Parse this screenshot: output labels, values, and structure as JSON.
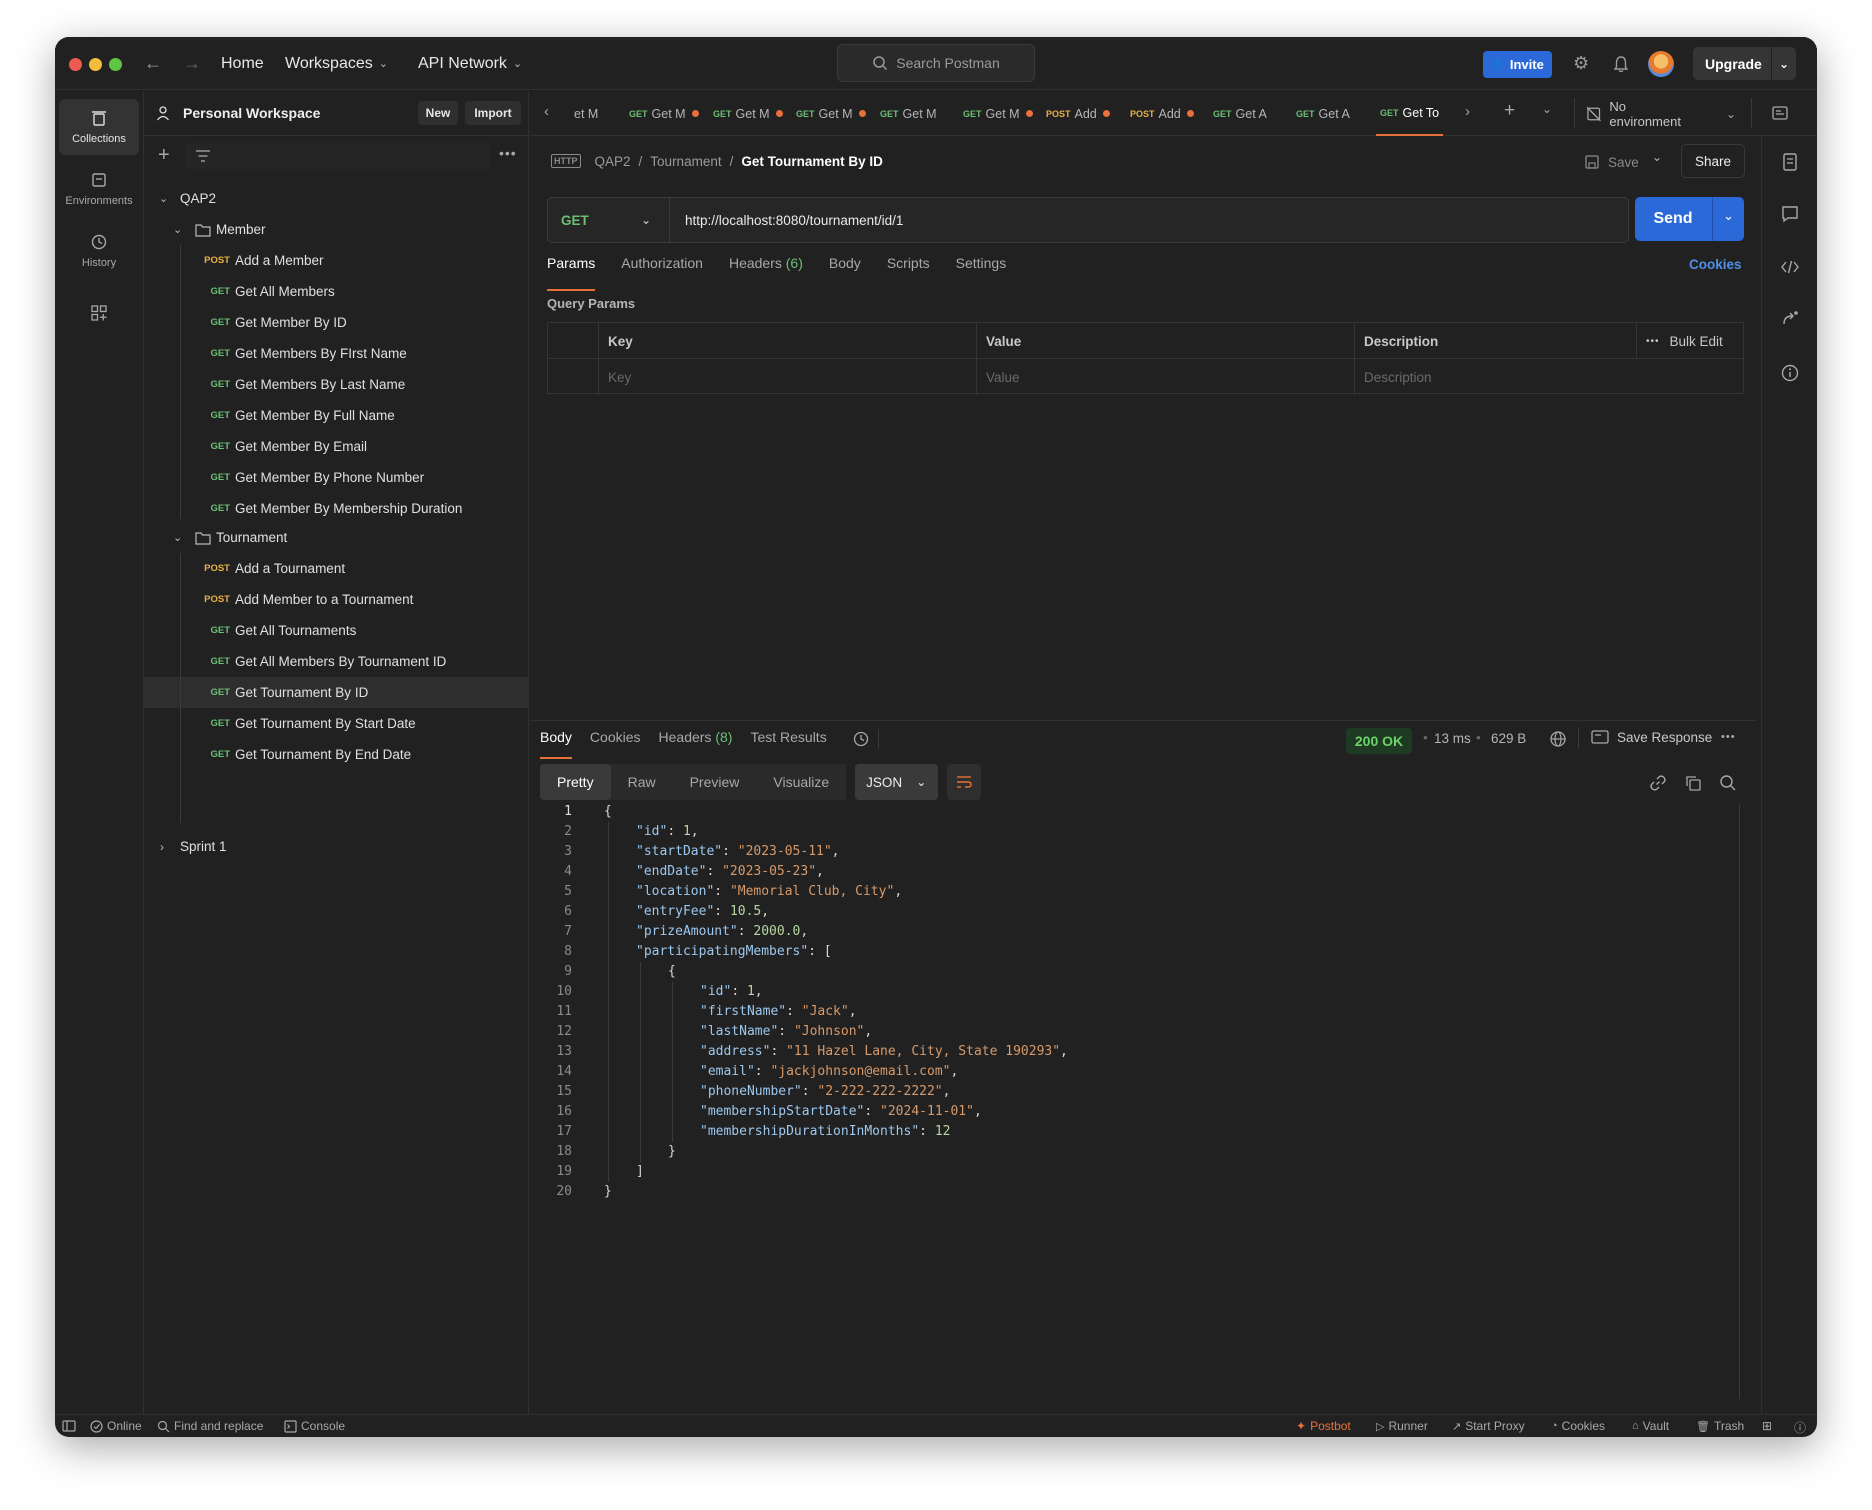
{
  "titlebar": {
    "home": "Home",
    "workspaces": "Workspaces",
    "api_network": "API Network",
    "search_placeholder": "Search Postman",
    "invite": "Invite",
    "upgrade": "Upgrade"
  },
  "rail": {
    "collections": "Collections",
    "environments": "Environments",
    "history": "History"
  },
  "sidebar": {
    "workspace_name": "Personal Workspace",
    "new_label": "New",
    "import_label": "Import",
    "collection": "QAP2",
    "folder_member": "Member",
    "member_items": [
      {
        "method": "POST",
        "label": "Add a Member"
      },
      {
        "method": "GET",
        "label": "Get All Members"
      },
      {
        "method": "GET",
        "label": "Get Member By ID"
      },
      {
        "method": "GET",
        "label": "Get Members By FIrst Name"
      },
      {
        "method": "GET",
        "label": "Get Members By Last Name"
      },
      {
        "method": "GET",
        "label": "Get Member By Full Name"
      },
      {
        "method": "GET",
        "label": "Get Member By Email"
      },
      {
        "method": "GET",
        "label": "Get Member By Phone Number"
      },
      {
        "method": "GET",
        "label": "Get Member By Membership Duration"
      }
    ],
    "folder_tournament": "Tournament",
    "tournament_items": [
      {
        "method": "POST",
        "label": "Add a Tournament"
      },
      {
        "method": "POST",
        "label": "Add Member to a Tournament"
      },
      {
        "method": "GET",
        "label": "Get All Tournaments"
      },
      {
        "method": "GET",
        "label": "Get All Members By Tournament ID"
      },
      {
        "method": "GET",
        "label": "Get Tournament By ID"
      },
      {
        "method": "GET",
        "label": "Get Tournament By Start Date"
      },
      {
        "method": "GET",
        "label": "Get Tournament By End Date"
      }
    ],
    "sprint": "Sprint 1"
  },
  "tabs": [
    {
      "method": "",
      "label": "et M",
      "dot": false
    },
    {
      "method": "GET",
      "label": "Get M",
      "dot": true
    },
    {
      "method": "GET",
      "label": "Get M",
      "dot": true
    },
    {
      "method": "GET",
      "label": "Get M",
      "dot": true
    },
    {
      "method": "GET",
      "label": "Get M",
      "dot": false
    },
    {
      "method": "GET",
      "label": "Get M",
      "dot": true
    },
    {
      "method": "POST",
      "label": "Add",
      "dot": true
    },
    {
      "method": "POST",
      "label": "Add",
      "dot": true
    },
    {
      "method": "GET",
      "label": "Get A",
      "dot": false
    },
    {
      "method": "GET",
      "label": "Get A",
      "dot": false
    },
    {
      "method": "GET",
      "label": "Get To",
      "dot": false
    }
  ],
  "environment": "No environment",
  "breadcrumb": {
    "collection": "QAP2",
    "folder": "Tournament",
    "request": "Get Tournament By ID",
    "save": "Save",
    "share": "Share"
  },
  "request": {
    "method": "GET",
    "url": "http://localhost:8080/tournament/id/1",
    "send": "Send",
    "tabs": {
      "params": "Params",
      "authorization": "Authorization",
      "headers": "Headers",
      "headers_count": "(6)",
      "body": "Body",
      "scripts": "Scripts",
      "settings": "Settings"
    },
    "cookies": "Cookies",
    "query_params_title": "Query Params",
    "table": {
      "key": "Key",
      "value": "Value",
      "description": "Description",
      "bulk_edit": "Bulk Edit",
      "key_placeholder": "Key",
      "value_placeholder": "Value",
      "description_placeholder": "Description"
    }
  },
  "response": {
    "tabs": {
      "body": "Body",
      "cookies": "Cookies",
      "headers": "Headers",
      "headers_count": "(8)",
      "test_results": "Test Results"
    },
    "status": "200 OK",
    "time": "13 ms",
    "size": "629 B",
    "save_response": "Save Response",
    "formats": {
      "pretty": "Pretty",
      "raw": "Raw",
      "preview": "Preview",
      "visualize": "Visualize",
      "json": "JSON"
    }
  },
  "statusbar": {
    "online": "Online",
    "find_replace": "Find and replace",
    "console": "Console",
    "postbot": "Postbot",
    "runner": "Runner",
    "start_proxy": "Start Proxy",
    "cookies": "Cookies",
    "vault": "Vault",
    "trash": "Trash"
  },
  "colors": {
    "accent": "#e8703a",
    "primary_blue": "#2b68d8",
    "get": "#6bbf73",
    "post": "#e8b048",
    "status_ok": "#6bd46b"
  }
}
